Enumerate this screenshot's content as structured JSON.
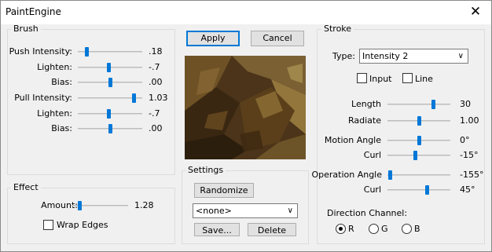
{
  "window": {
    "title": "PaintEngine",
    "close_glyph": "✕"
  },
  "brush": {
    "group_label": "Brush",
    "rows": [
      {
        "label": "Push Intensity:",
        "value": ".18",
        "level": 0.14
      },
      {
        "label": "Lighten:",
        "value": "-.7",
        "level": 0.48
      },
      {
        "label": "Bias:",
        "value": ".00",
        "level": 0.5
      },
      {
        "label": "Pull Intensity:",
        "value": "1.03",
        "level": 0.86
      },
      {
        "label": "Lighten:",
        "value": "-.7",
        "level": 0.48
      },
      {
        "label": "Bias:",
        "value": ".00",
        "level": 0.5
      }
    ]
  },
  "effect": {
    "group_label": "Effect",
    "amount_label": "Amount:",
    "amount_value": "1.28",
    "amount_level": 0.14,
    "wrap_edges_label": "Wrap Edges",
    "wrap_edges_checked": false
  },
  "actions": {
    "apply_label": "Apply",
    "cancel_label": "Cancel"
  },
  "settings": {
    "group_label": "Settings",
    "randomize_label": "Randomize",
    "preset_value": "<none>",
    "save_label": "Save...",
    "delete_label": "Delete"
  },
  "stroke": {
    "group_label": "Stroke",
    "type_label": "Type:",
    "type_value": "Intensity 2",
    "input_label": "Input",
    "input_checked": false,
    "line_label": "Line",
    "line_checked": false,
    "length_label": "Length",
    "length_value": "30",
    "length_level": 0.72,
    "radiate_label": "Radiate",
    "radiate_value": "1.00",
    "radiate_level": 0.5,
    "motion_angle_label": "Motion Angle",
    "motion_angle_value": "0°",
    "motion_angle_level": 0.5,
    "curl1_label": "Curl",
    "curl1_value": "-15°",
    "curl1_level": 0.44,
    "operation_angle_label": "Operation Angle",
    "operation_angle_value": "-155°",
    "operation_angle_level": 0.04,
    "curl2_label": "Curl",
    "curl2_value": "45°",
    "curl2_level": 0.62,
    "direction_channel_label": "Direction Channel:",
    "channels": [
      {
        "label": "R",
        "selected": true
      },
      {
        "label": "G",
        "selected": false
      },
      {
        "label": "B",
        "selected": false
      }
    ]
  }
}
